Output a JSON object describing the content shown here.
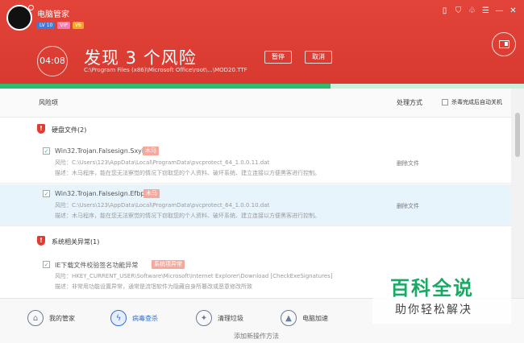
{
  "header": {
    "app_title": "电脑管家",
    "badges": [
      "LV 10",
      "VIP",
      "V6"
    ],
    "timer": "04:08",
    "headline": "发现 3 个风险",
    "scan_path": "C:\\Program Files (x86)\\Microsoft Office\\root\\...\\MOD20.TTF",
    "pause_label": "暂停",
    "cancel_label": "取消",
    "progress_percent": 63,
    "colors": {
      "accent": "#d8392f",
      "progress": "#2dbd6e"
    }
  },
  "columns": {
    "risk": "风险项",
    "action": "处理方式",
    "auto_shutdown": "杀毒完成后自动关机"
  },
  "groups": [
    {
      "label": "硬盘文件(2)",
      "items": [
        {
          "name": "Win32.Trojan.Falsesign.Sxyl",
          "tag": "木马",
          "risk": "风险：C:\\Users\\123\\AppData\\Local\\ProgramData\\pvcprotect_64_1.0.0.11.dat",
          "desc": "描述：木马程序，能在您无法察觉的情况下窃取您的个人资料、破坏系统、建立连接以方便黑客进行控制。",
          "action": "删除文件"
        },
        {
          "name": "Win32.Trojan.Falsesign.Efbp",
          "tag": "木马",
          "risk": "风险：C:\\Users\\123\\AppData\\Local\\ProgramData\\pvcprotect_64_1.0.0.10.dat",
          "desc": "描述：木马程序，能在您无法察觉的情况下窃取您的个人资料、破坏系统、建立连接以方便黑客进行控制。",
          "action": "删除文件"
        }
      ]
    },
    {
      "label": "系统相关异常(1)",
      "items": [
        {
          "name": "IE下载文件校验签名功能异常",
          "tag": "系统项异常",
          "risk": "风险：HKEY_CURRENT_USER\\Software\\Microsoft\\Internet Explorer\\Download [CheckExeSignatures]",
          "desc": "描述：非常用功能设置异常，通常是流氓软件为隐藏自身所篡改或恶意修改所致"
        }
      ]
    }
  ],
  "bottom_nav": [
    {
      "label": "我的管家",
      "icon": "home-icon"
    },
    {
      "label": "病毒查杀",
      "icon": "shield-scan-icon"
    },
    {
      "label": "清理垃圾",
      "icon": "broom-icon"
    },
    {
      "label": "电脑加速",
      "icon": "rocket-icon"
    }
  ],
  "below_text": "添加新操作方法",
  "watermark": {
    "big": "百科全说",
    "small": "助你轻松解决"
  }
}
